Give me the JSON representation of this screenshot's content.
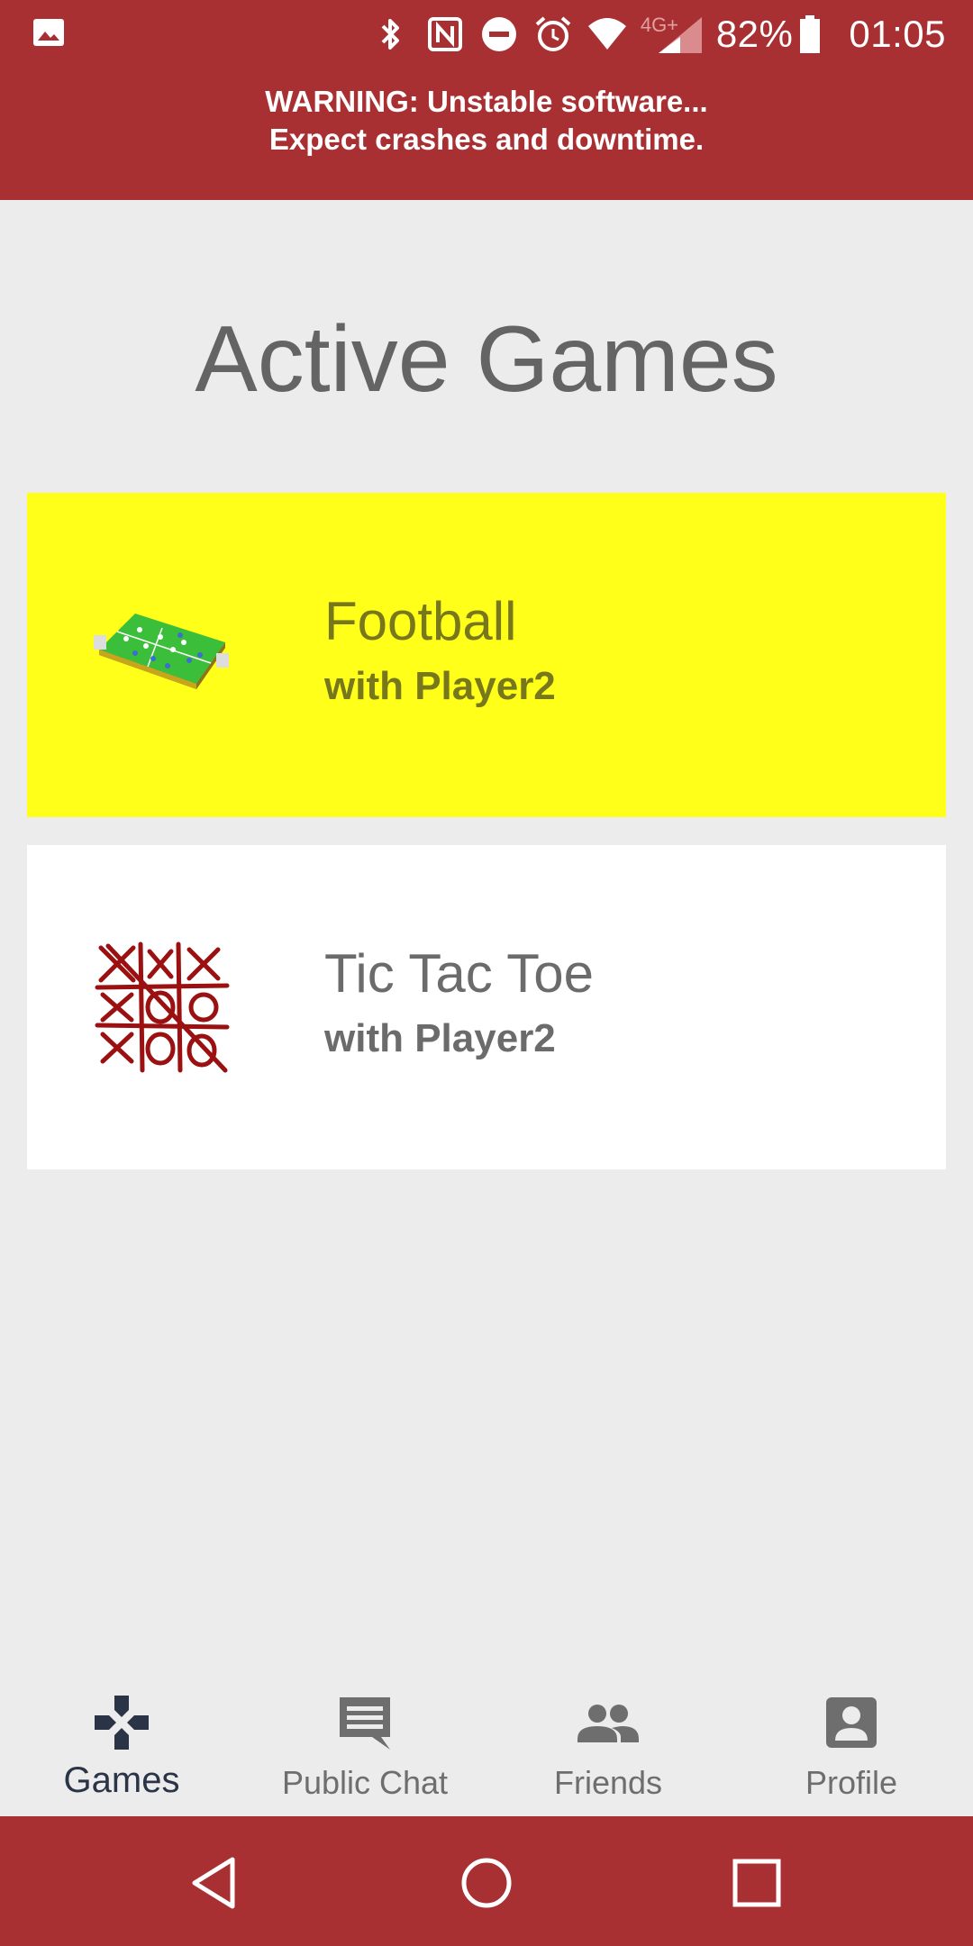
{
  "status_bar": {
    "battery": "82%",
    "time": "01:05",
    "network": "4G+",
    "icons": [
      "image-icon",
      "bluetooth-icon",
      "nfc-icon",
      "do-not-disturb-icon",
      "alarm-icon",
      "wifi-icon",
      "signal-icon",
      "battery-icon"
    ]
  },
  "banner": {
    "line1": "WARNING: Unstable software...",
    "line2": "Expect crashes and downtime."
  },
  "main": {
    "title": "Active Games",
    "games": [
      {
        "name": "Football",
        "opponent": "with Player2",
        "icon": "football-field-icon",
        "highlighted": true,
        "bg": "#ffff1a"
      },
      {
        "name": "Tic Tac Toe",
        "opponent": "with Player2",
        "icon": "tic-tac-toe-icon",
        "highlighted": false,
        "bg": "#ffffff"
      }
    ]
  },
  "bottom_nav": {
    "items": [
      {
        "label": "Games",
        "icon": "gamepad-icon",
        "active": true
      },
      {
        "label": "Public Chat",
        "icon": "chat-icon",
        "active": false
      },
      {
        "label": "Friends",
        "icon": "friends-icon",
        "active": false
      },
      {
        "label": "Profile",
        "icon": "profile-icon",
        "active": false
      }
    ]
  },
  "system_nav": {
    "buttons": [
      "back-icon",
      "home-icon",
      "recents-icon"
    ]
  },
  "colors": {
    "accent": "#a83033",
    "highlight": "#ffff1a",
    "active_nav": "#2b3447"
  }
}
